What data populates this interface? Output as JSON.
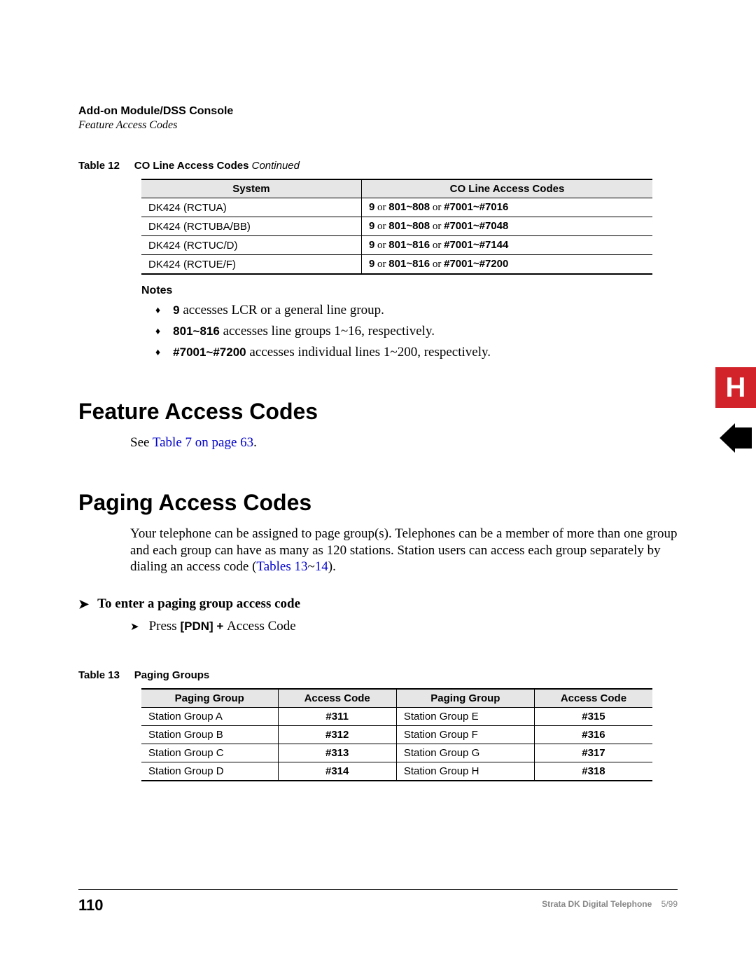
{
  "header": {
    "chapter": "Add-on Module/DSS Console",
    "section": "Feature Access Codes"
  },
  "table12": {
    "caption_label": "Table 12",
    "caption_title": "CO Line Access Codes",
    "caption_suffix": "Continued",
    "headers": {
      "system": "System",
      "codes": "CO Line Access Codes"
    },
    "rows": [
      {
        "system": "DK424 (RCTUA)",
        "pre": "9",
        "or1": " or ",
        "mid": "801~808",
        "or2": " or ",
        "end": "#7001~#7016"
      },
      {
        "system": "DK424 (RCTUBA/BB)",
        "pre": "9",
        "or1": " or ",
        "mid": "801~808",
        "or2": " or ",
        "end": "#7001~#7048"
      },
      {
        "system": "DK424 (RCTUC/D)",
        "pre": "9",
        "or1": " or ",
        "mid": "801~816",
        "or2": " or ",
        "end": "#7001~#7144"
      },
      {
        "system": "DK424 (RCTUE/F)",
        "pre": "9",
        "or1": " or ",
        "mid": "801~816",
        "or2": " or ",
        "end": "#7001~#7200"
      }
    ]
  },
  "notes": {
    "heading": "Notes",
    "items": [
      {
        "code": "9",
        "text": " accesses LCR or a general line group."
      },
      {
        "code": "801~816",
        "text": " accesses line groups 1~16, respectively."
      },
      {
        "code": "#7001~#7200",
        "text": " accesses individual lines 1~200, respectively."
      }
    ]
  },
  "feature_section": {
    "heading": "Feature Access Codes",
    "para_pre": "See ",
    "para_link": "Table 7 on page 63",
    "para_post": "."
  },
  "paging_section": {
    "heading": "Paging Access Codes",
    "para_pre": "Your telephone can be assigned to page group(s). Telephones can be a member of more than one group and each group can have as many as 120 stations. Station users can access each group separately by dialing an access code (",
    "para_link1": "Tables 13",
    "para_tilde": "~",
    "para_link2": "14",
    "para_post": ").",
    "proc_heading": "To enter a paging group access code",
    "step_pre": "Press ",
    "step_key": "[PDN]",
    "step_plus": " + ",
    "step_post": "Access Code"
  },
  "table13": {
    "caption_label": "Table 13",
    "caption_title": "Paging Groups",
    "headers": {
      "pg": "Paging Group",
      "ac": "Access Code"
    },
    "rows": [
      {
        "g1": "Station Group A",
        "c1": "#311",
        "g2": "Station Group E",
        "c2": "#315"
      },
      {
        "g1": "Station Group B",
        "c1": "#312",
        "g2": "Station Group F",
        "c2": "#316"
      },
      {
        "g1": "Station Group C",
        "c1": "#313",
        "g2": "Station Group G",
        "c2": "#317"
      },
      {
        "g1": "Station Group D",
        "c1": "#314",
        "g2": "Station Group H",
        "c2": "#318"
      }
    ]
  },
  "footer": {
    "page": "110",
    "doc_title": "Strata DK Digital Telephone",
    "doc_date": "5/99"
  },
  "tabs": {
    "letter": "H"
  }
}
